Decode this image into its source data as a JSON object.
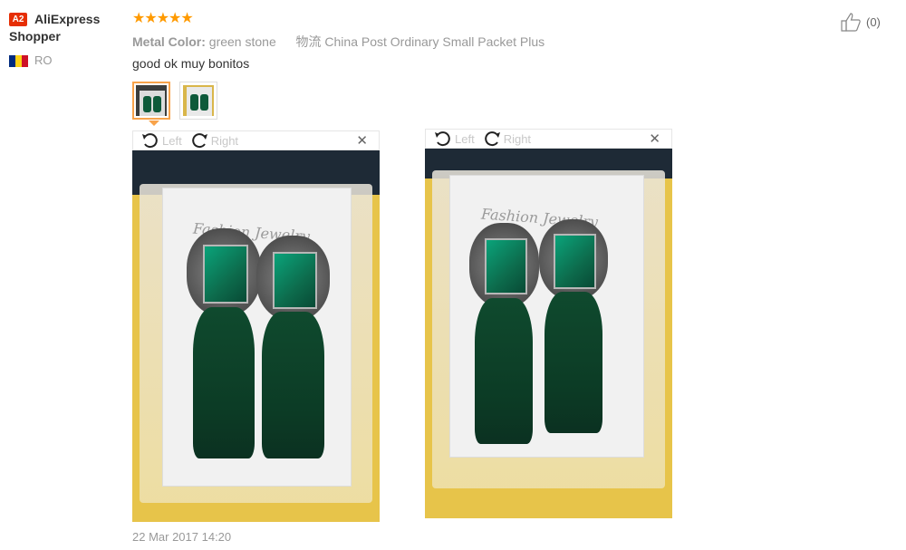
{
  "reviewer": {
    "badge": "A2",
    "name": "AliExpress Shopper",
    "country": "RO",
    "flag_colors": [
      "#002b7f",
      "#fcd116",
      "#ce1126"
    ]
  },
  "review": {
    "stars": "★★★★★",
    "rating": 5,
    "attr_key": "Metal Color:",
    "attr_value": "green stone",
    "shipping_icon": "物流",
    "shipping": "China Post Ordinary Small Packet Plus",
    "text": "good ok muy bonitos",
    "timestamp": "22 Mar 2017 14:20"
  },
  "helpful": {
    "icon": "thumbs-up-icon",
    "count": "(0)"
  },
  "viewer": {
    "left_label": "Left",
    "right_label": "Right",
    "close_label": "✕",
    "card_text": "Fashion Jewelry"
  },
  "colors": {
    "accent": "#f8a34a",
    "star": "#ff9a00",
    "badge": "#e62e04"
  }
}
